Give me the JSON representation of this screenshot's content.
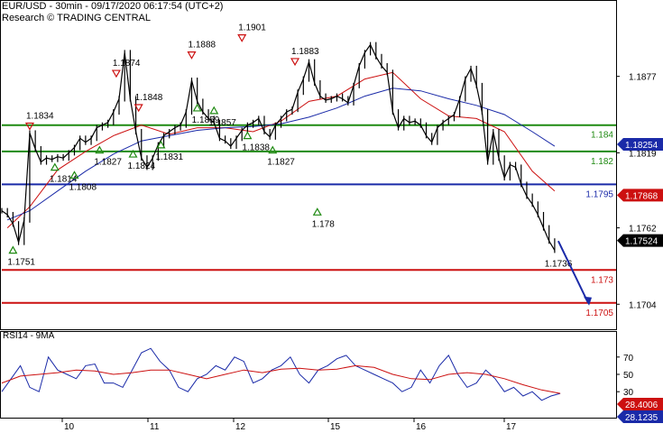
{
  "header": {
    "title": "EUR/USD - 30min - 09/17/2020 06:17:54 (UTC+2)",
    "source": "Research © TRADING CENTRAL"
  },
  "rsi_panel": {
    "title": "RSI14 - 9MA"
  },
  "chart_data": [
    {
      "type": "line",
      "subtype": "candlestick with moving averages",
      "x_tick_labels": [
        "10",
        "11",
        "12",
        "15",
        "16",
        "17"
      ],
      "y_tick_labels": [
        "1.1877",
        "1.1819",
        "1.1762",
        "1.1704"
      ],
      "ylim": [
        1.1685,
        1.1935
      ],
      "horizontal_levels": [
        {
          "value": 1.184,
          "label": "1.184",
          "color": "#1f8a12"
        },
        {
          "value": 1.182,
          "label": "1.182",
          "color": "#1f8a12"
        },
        {
          "value": 1.1795,
          "label": "1.1795",
          "color": "#1a2aa8"
        },
        {
          "value": 1.173,
          "label": "1.173",
          "color": "#cc1010"
        },
        {
          "value": 1.1705,
          "label": "1.1705",
          "color": "#cc1010"
        }
      ],
      "price_boxes": [
        {
          "value": 1.18254,
          "label": "1.18254",
          "bg": "#1a2aa8",
          "fg": "#ffffff"
        },
        {
          "value": 1.17868,
          "label": "1.17868",
          "bg": "#cc1010",
          "fg": "#ffffff"
        },
        {
          "value": 1.17524,
          "label": "1.17524",
          "bg": "#000000",
          "fg": "#ffffff"
        }
      ],
      "series": [
        {
          "name": "price",
          "color": "#000000",
          "x": [
            0,
            2,
            4,
            6,
            8,
            10,
            12,
            14,
            16,
            18,
            20,
            22,
            24,
            26,
            28,
            30,
            32,
            34,
            36,
            38,
            40,
            42,
            44,
            46,
            48,
            50,
            52,
            54,
            56,
            58,
            60,
            62,
            64,
            66,
            68,
            70,
            72,
            74,
            76,
            78,
            80,
            82,
            84,
            86,
            88,
            90,
            92,
            94,
            96,
            98,
            100,
            102,
            104,
            106,
            108,
            110,
            112,
            114,
            116,
            118,
            120,
            122,
            124,
            126,
            128,
            130,
            132,
            134,
            136,
            138,
            140,
            142,
            144,
            146,
            148,
            150,
            152,
            154,
            156,
            158,
            160,
            162,
            164,
            166,
            168,
            170,
            172,
            174,
            176,
            178,
            180,
            182,
            184,
            186,
            188,
            190,
            192,
            194,
            196,
            198
          ],
          "values": [
            1.1775,
            1.1772,
            1.1765,
            1.1751,
            1.1768,
            1.1834,
            1.1822,
            1.1812,
            1.1815,
            1.1814,
            1.1816,
            1.1815,
            1.1819,
            1.1823,
            1.183,
            1.1827,
            1.183,
            1.1838,
            1.184,
            1.1842,
            1.185,
            1.186,
            1.1895,
            1.186,
            1.1835,
            1.1815,
            1.1808,
            1.1815,
            1.1825,
            1.1832,
            1.1835,
            1.1838,
            1.184,
            1.185,
            1.1874,
            1.1858,
            1.185,
            1.1845,
            1.1842,
            1.183,
            1.1828,
            1.1824,
            1.183,
            1.1836,
            1.184,
            1.1842,
            1.1845,
            1.1835,
            1.1831,
            1.184,
            1.1845,
            1.185,
            1.1852,
            1.1865,
            1.1875,
            1.1888,
            1.1872,
            1.1862,
            1.1859,
            1.186,
            1.1862,
            1.186,
            1.1857,
            1.187,
            1.1885,
            1.1895,
            1.1901,
            1.1892,
            1.1885,
            1.188,
            1.185,
            1.1838,
            1.1845,
            1.1842,
            1.1843,
            1.184,
            1.1832,
            1.1827,
            1.1838,
            1.1842,
            1.1845,
            1.1848,
            1.186,
            1.1875,
            1.1883,
            1.187,
            1.185,
            1.1812,
            1.1835,
            1.1815,
            1.18,
            1.181,
            1.1808,
            1.1795,
            1.1786,
            1.178,
            1.1772,
            1.1762,
            1.1752,
            1.1745
          ]
        },
        {
          "name": "fast MA",
          "color": "#cc1010",
          "x": [
            2,
            10,
            20,
            30,
            40,
            50,
            60,
            70,
            80,
            90,
            100,
            110,
            120,
            130,
            140,
            150,
            160,
            170,
            180,
            190,
            198
          ],
          "values": [
            1.1762,
            1.1778,
            1.1806,
            1.182,
            1.1832,
            1.184,
            1.1833,
            1.1838,
            1.1838,
            1.1835,
            1.1843,
            1.1858,
            1.1862,
            1.1875,
            1.188,
            1.186,
            1.1847,
            1.1845,
            1.1835,
            1.1805,
            1.179
          ]
        },
        {
          "name": "slow MA",
          "color": "#1a2aa8",
          "x": [
            2,
            10,
            20,
            30,
            40,
            50,
            60,
            70,
            80,
            90,
            100,
            110,
            120,
            130,
            140,
            150,
            160,
            170,
            180,
            190,
            198
          ],
          "values": [
            1.1768,
            1.1775,
            1.179,
            1.1805,
            1.1818,
            1.1828,
            1.1832,
            1.1836,
            1.1838,
            1.1839,
            1.1841,
            1.1846,
            1.1853,
            1.1862,
            1.1868,
            1.1866,
            1.186,
            1.1855,
            1.1848,
            1.1835,
            1.1824
          ]
        }
      ],
      "pivot_labels": [
        {
          "x": 10,
          "value": 1.1834,
          "label": "1.1834",
          "dir": "down"
        },
        {
          "x": 4,
          "value": 1.1751,
          "label": "1.1751",
          "dir": "up"
        },
        {
          "x": 19,
          "value": 1.1814,
          "label": "1.1814",
          "dir": "up"
        },
        {
          "x": 26,
          "value": 1.1808,
          "label": "1.1808",
          "dir": "up"
        },
        {
          "x": 35,
          "value": 1.1827,
          "label": "1.1827",
          "dir": "up"
        },
        {
          "x": 41,
          "value": 1.1874,
          "label": "1.1874",
          "dir": "down"
        },
        {
          "x": 47,
          "value": 1.1824,
          "label": "1.1824",
          "dir": "up"
        },
        {
          "x": 49,
          "value": 1.1848,
          "label": "1.1848",
          "dir": "down"
        },
        {
          "x": 57,
          "value": 1.1831,
          "label": "1.1831",
          "dir": "up"
        },
        {
          "x": 68,
          "value": 1.1888,
          "label": "1.1888",
          "dir": "down"
        },
        {
          "x": 70,
          "value": 1.1859,
          "label": "1.1859",
          "dir": "up"
        },
        {
          "x": 76,
          "value": 1.1857,
          "label": "1.1857",
          "dir": "up"
        },
        {
          "x": 86,
          "value": 1.1901,
          "label": "1.1901",
          "dir": "down"
        },
        {
          "x": 88,
          "value": 1.1838,
          "label": "1.1838",
          "dir": "up"
        },
        {
          "x": 97,
          "value": 1.1827,
          "label": "1.1827",
          "dir": "up"
        },
        {
          "x": 105,
          "value": 1.1883,
          "label": "1.1883",
          "dir": "down"
        },
        {
          "x": 113,
          "value": 1.178,
          "label": "1.178",
          "dir": "up"
        }
      ],
      "annotations": [
        {
          "label": "1.1736",
          "value": 1.1736
        }
      ],
      "forecast_arrow": {
        "from": 1.1752,
        "to": 1.1705,
        "color": "#1a2aa8"
      }
    },
    {
      "type": "line",
      "subtype": "RSI",
      "y_tick_labels": [
        "70",
        "50",
        "30"
      ],
      "ylim": [
        0,
        100
      ],
      "price_boxes": [
        {
          "value": 28.4006,
          "label": "28.4006",
          "bg": "#cc1010",
          "fg": "#ffffff"
        },
        {
          "value": 28.1235,
          "label": "28.1235",
          "bg": "#1a2aa8",
          "fg": "#ffffff"
        }
      ],
      "series": [
        {
          "name": "RSI14",
          "color": "#1a2aa8",
          "x": [
            0,
            5,
            10,
            15,
            20,
            25,
            30,
            35,
            40,
            45,
            50,
            55,
            60,
            65,
            70,
            75,
            80,
            85,
            90,
            95,
            100,
            105,
            110,
            115,
            120,
            125,
            130,
            135,
            140,
            145,
            150,
            155,
            160,
            165,
            170,
            175,
            180,
            185,
            190,
            195,
            200,
            205,
            210,
            215,
            220,
            225,
            230,
            235,
            240,
            245,
            250,
            255,
            260,
            265,
            270,
            275,
            280,
            285,
            290,
            295,
            300
          ],
          "values": [
            30,
            45,
            60,
            35,
            30,
            70,
            55,
            50,
            45,
            60,
            62,
            40,
            40,
            35,
            55,
            75,
            80,
            65,
            55,
            35,
            30,
            45,
            50,
            60,
            55,
            70,
            65,
            40,
            45,
            55,
            60,
            70,
            50,
            40,
            55,
            60,
            68,
            72,
            60,
            55,
            50,
            45,
            40,
            30,
            35,
            55,
            40,
            60,
            72,
            50,
            35,
            40,
            55,
            45,
            30,
            35,
            25,
            30,
            20,
            25,
            28
          ]
        },
        {
          "name": "9MA",
          "color": "#cc1010",
          "x": [
            0,
            10,
            20,
            30,
            40,
            50,
            60,
            70,
            80,
            90,
            100,
            110,
            120,
            130,
            140,
            150,
            160,
            170,
            180,
            190,
            200,
            210,
            220,
            230,
            240,
            250,
            260,
            270,
            280,
            290,
            300
          ],
          "values": [
            40,
            48,
            50,
            52,
            55,
            54,
            50,
            52,
            55,
            55,
            50,
            45,
            50,
            55,
            52,
            56,
            57,
            55,
            56,
            60,
            58,
            50,
            45,
            44,
            50,
            52,
            50,
            45,
            38,
            32,
            28
          ]
        }
      ]
    }
  ]
}
